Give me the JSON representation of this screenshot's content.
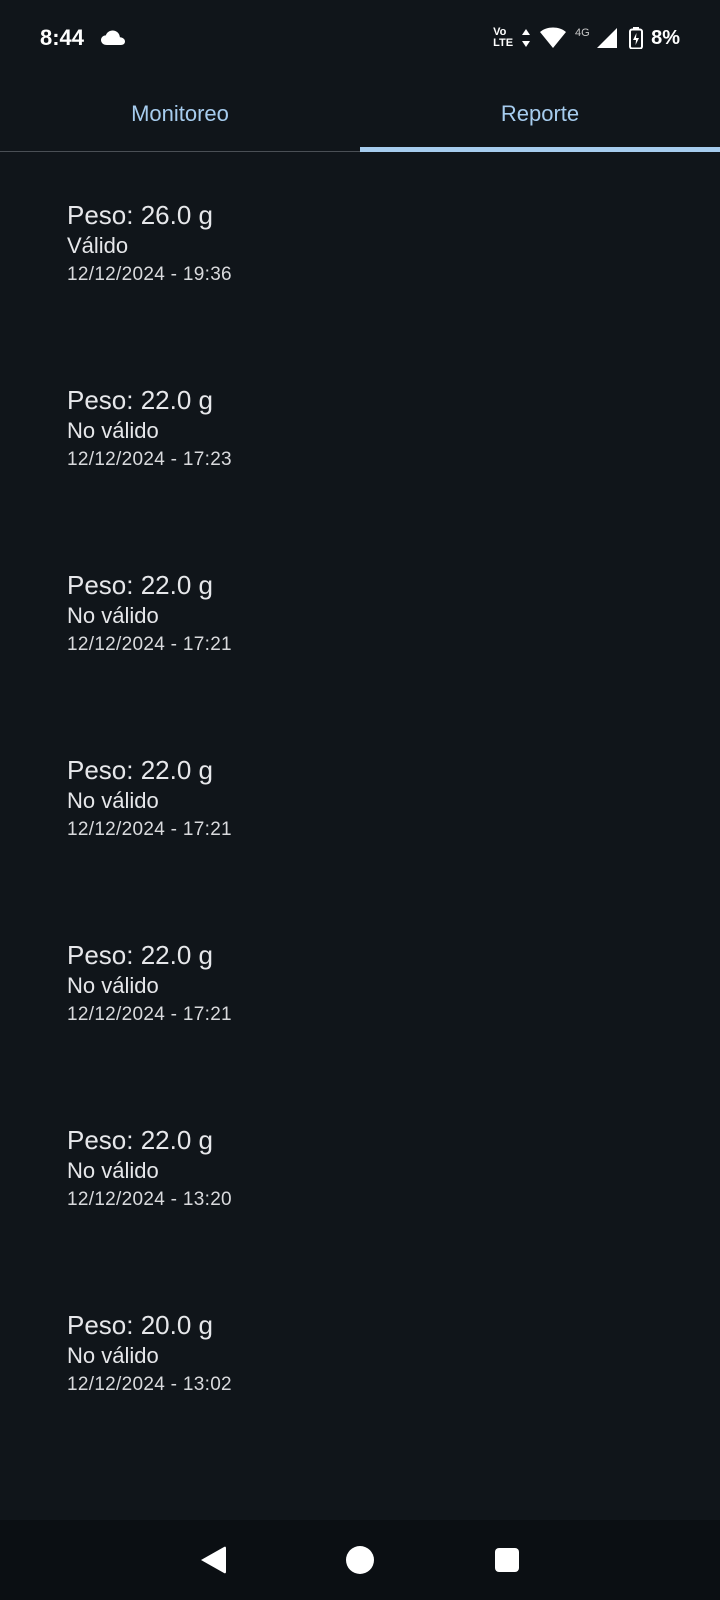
{
  "status_bar": {
    "time": "8:44",
    "volte_top": "Vo",
    "volte_bottom": "LTE",
    "network": "4G",
    "battery": "8%",
    "icons": [
      "cloud-icon",
      "volte-icon",
      "data-arrows-icon",
      "wifi-icon",
      "cell-signal-icon",
      "battery-charging-icon"
    ]
  },
  "tabs": [
    {
      "label": "Monitoreo",
      "active": false
    },
    {
      "label": "Reporte",
      "active": true
    }
  ],
  "reports": [
    {
      "weight": "Peso: 26.0 g",
      "status": "Válido",
      "datetime": "12/12/2024 - 19:36"
    },
    {
      "weight": "Peso: 22.0 g",
      "status": "No válido",
      "datetime": "12/12/2024 - 17:23"
    },
    {
      "weight": "Peso: 22.0 g",
      "status": "No válido",
      "datetime": "12/12/2024 - 17:21"
    },
    {
      "weight": "Peso: 22.0 g",
      "status": "No válido",
      "datetime": "12/12/2024 - 17:21"
    },
    {
      "weight": "Peso: 22.0 g",
      "status": "No válido",
      "datetime": "12/12/2024 - 17:21"
    },
    {
      "weight": "Peso: 22.0 g",
      "status": "No válido",
      "datetime": "12/12/2024 - 13:20"
    },
    {
      "weight": "Peso: 20.0 g",
      "status": "No válido",
      "datetime": "12/12/2024 - 13:02"
    }
  ],
  "navbar": {
    "icons": [
      "back-icon",
      "home-icon",
      "recents-icon"
    ]
  },
  "colors": {
    "background": "#10151a",
    "accent": "#a6ccee",
    "text": "#e6e7ea"
  }
}
